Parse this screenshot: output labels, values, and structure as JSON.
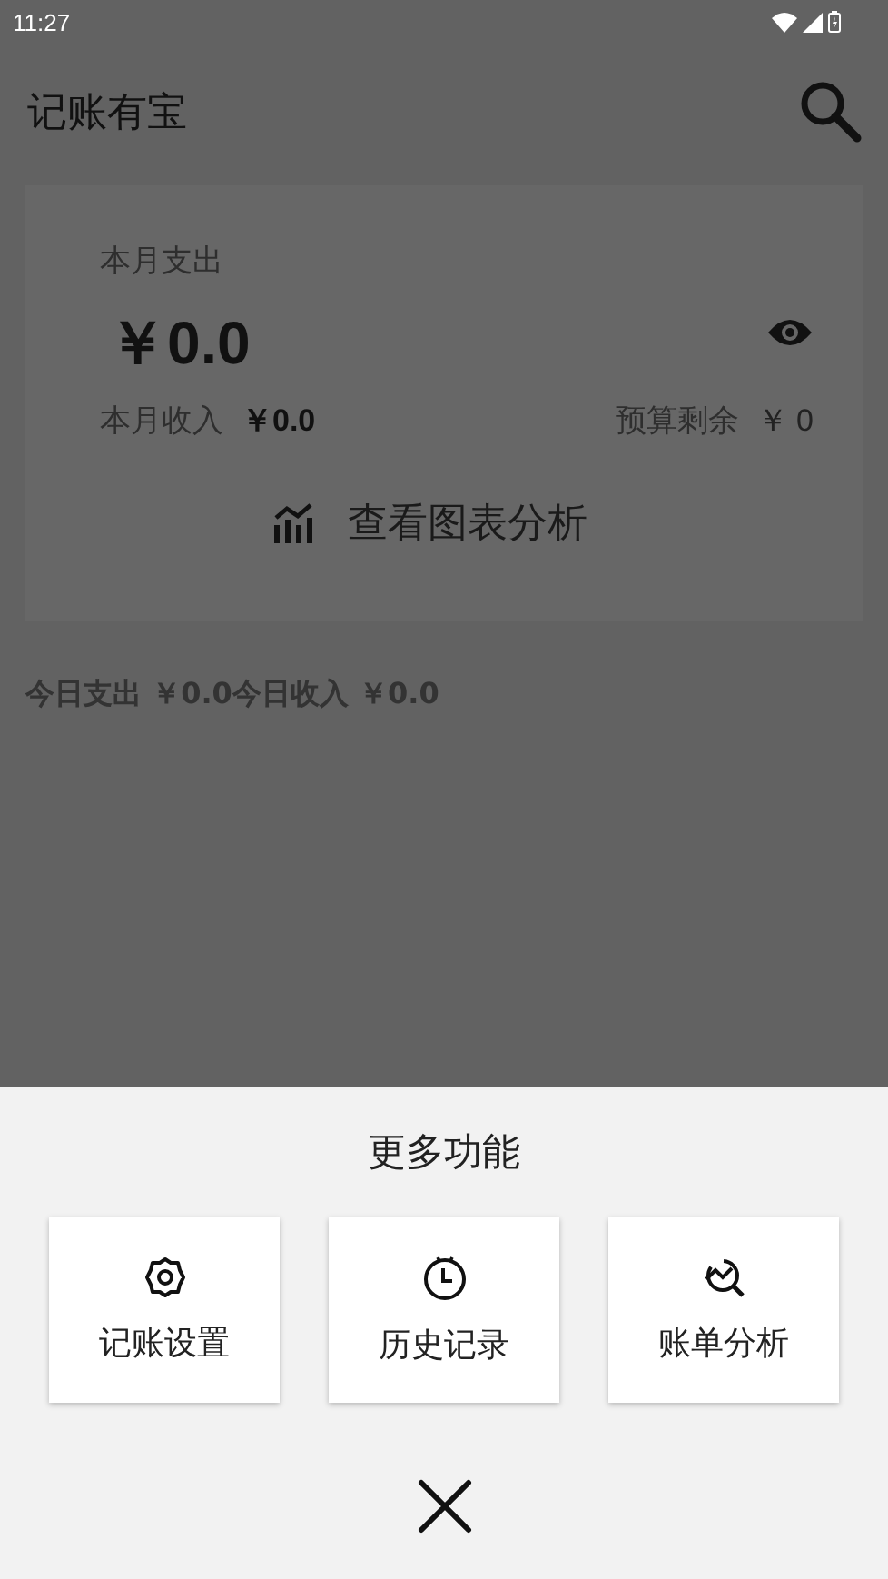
{
  "status_bar": {
    "time": "11:27"
  },
  "app_bar": {
    "title": "记账有宝"
  },
  "summary_card": {
    "label": "本月支出",
    "amount": "￥0.0",
    "income_label": "本月收入",
    "income_value": "￥0.0",
    "budget_label": "预算剩余",
    "budget_value": "￥ 0",
    "chart_link": "查看图表分析"
  },
  "today_line": "今日支出 ￥0.0今日收入 ￥0.0",
  "sheet": {
    "title": "更多功能",
    "items": [
      {
        "kind": "settings",
        "label": "记账设置"
      },
      {
        "kind": "history",
        "label": "历史记录"
      },
      {
        "kind": "analysis",
        "label": "账单分析"
      }
    ]
  }
}
